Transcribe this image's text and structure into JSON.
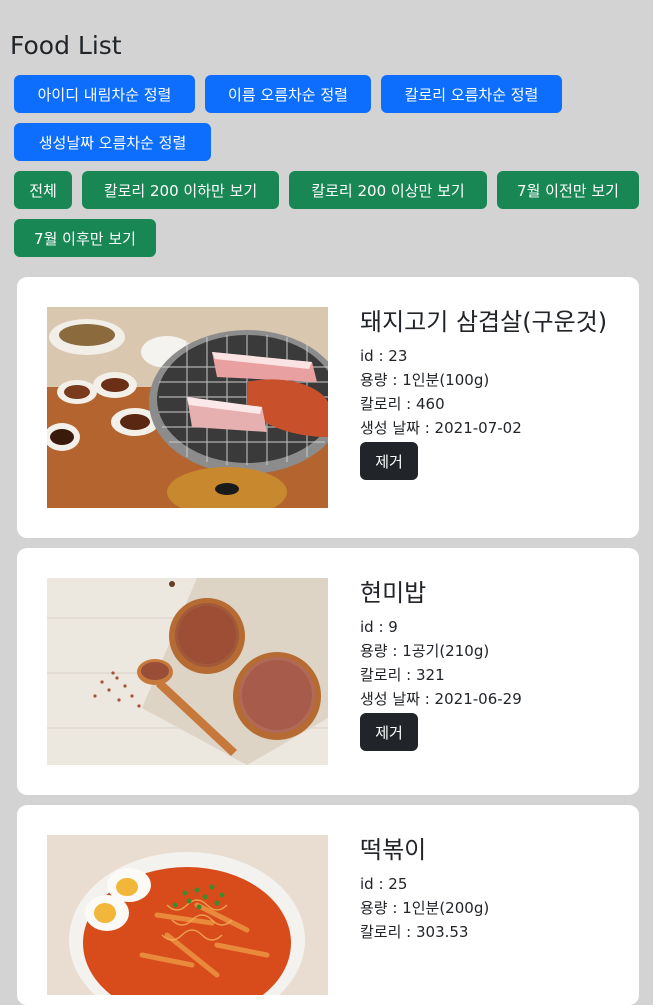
{
  "page": {
    "title": "Food List"
  },
  "sort_buttons": [
    {
      "label": "아이디 내림차순 정렬"
    },
    {
      "label": "이름 오름차순 정렬"
    },
    {
      "label": "칼로리 오름차순 정렬"
    },
    {
      "label": "생성날짜 오름차순 정렬"
    }
  ],
  "filter_buttons": [
    {
      "label": "전체"
    },
    {
      "label": "칼로리 200 이하만 보기"
    },
    {
      "label": "칼로리 200 이상만 보기"
    },
    {
      "label": "7월 이전만 보기"
    },
    {
      "label": "7월 이후만 보기"
    }
  ],
  "foods": [
    {
      "name": "돼지고기 삼겹살(구운것)",
      "id_text": "id : 23",
      "amount_text": "용량 : 1인분(100g)",
      "calorie_text": "칼로리 : 460",
      "date_text": "생성 날짜 : 2021-07-02",
      "remove_label": "제거",
      "image_icon": "grilled-pork-belly-photo"
    },
    {
      "name": "현미밥",
      "id_text": "id : 9",
      "amount_text": "용량 : 1공기(210g)",
      "calorie_text": "칼로리 : 321",
      "date_text": "생성 날짜 : 2021-06-29",
      "remove_label": "제거",
      "image_icon": "brown-rice-photo"
    },
    {
      "name": "떡볶이",
      "id_text": "id : 25",
      "amount_text": "용량 : 1인분(200g)",
      "calorie_text": "칼로리 : 303.53",
      "image_icon": "tteokbokki-photo"
    }
  ]
}
